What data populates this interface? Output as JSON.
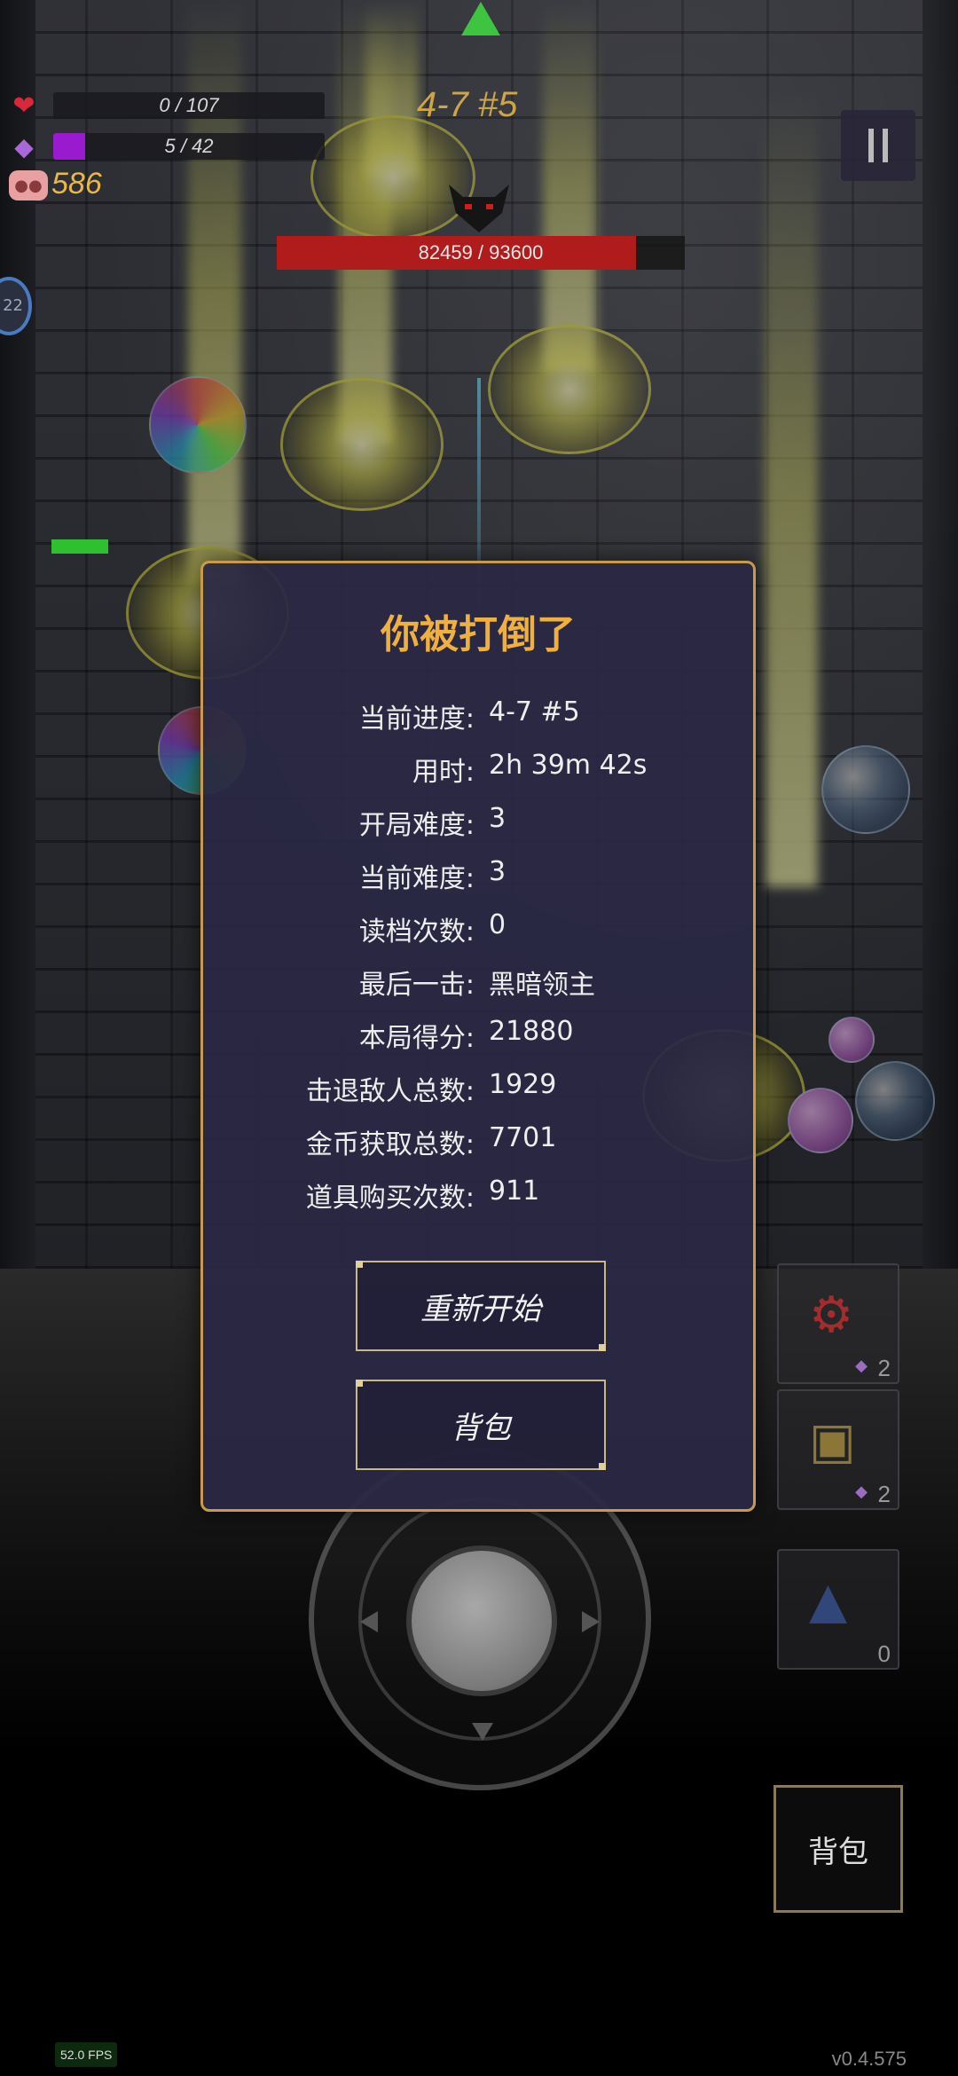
{
  "hud": {
    "hp_text": "0 / 107",
    "hp_fraction": 0.0,
    "mana_text": "5 / 42",
    "mana_fraction": 0.119,
    "gold": "586",
    "stage": "4-7 #5",
    "boss_hp_text": "82459 / 93600",
    "boss_hp_fraction": 0.881,
    "badge_left": "22",
    "colors": {
      "hp": "#c0202a",
      "mana": "#9a1ad0",
      "gold": "#e8b84a",
      "boss_hp": "#b01c1c"
    }
  },
  "slots": [
    {
      "icon": "red-potion-icon",
      "count": "2"
    },
    {
      "icon": "gold-crate-icon",
      "count": "2"
    },
    {
      "icon": "blue-potion-icon",
      "count": "0"
    }
  ],
  "dialog": {
    "title": "你被打倒了",
    "stats": [
      {
        "label": "当前进度:",
        "value": "4-7 #5"
      },
      {
        "label": "用时:",
        "value": "2h 39m 42s"
      },
      {
        "label": "开局难度:",
        "value": "3"
      },
      {
        "label": "当前难度:",
        "value": "3"
      },
      {
        "label": "读档次数:",
        "value": "0"
      },
      {
        "label": "最后一击:",
        "value": "黑暗领主"
      },
      {
        "label": "本局得分:",
        "value": "21880"
      },
      {
        "label": "击退敌人总数:",
        "value": "1929"
      },
      {
        "label": "金币获取总数:",
        "value": "7701"
      },
      {
        "label": "道具购买次数:",
        "value": "911"
      }
    ],
    "restart_label": "重新开始",
    "bag_label": "背包"
  },
  "bag_button_label": "背包",
  "fps": "52.0 FPS",
  "version": "v0.4.575"
}
